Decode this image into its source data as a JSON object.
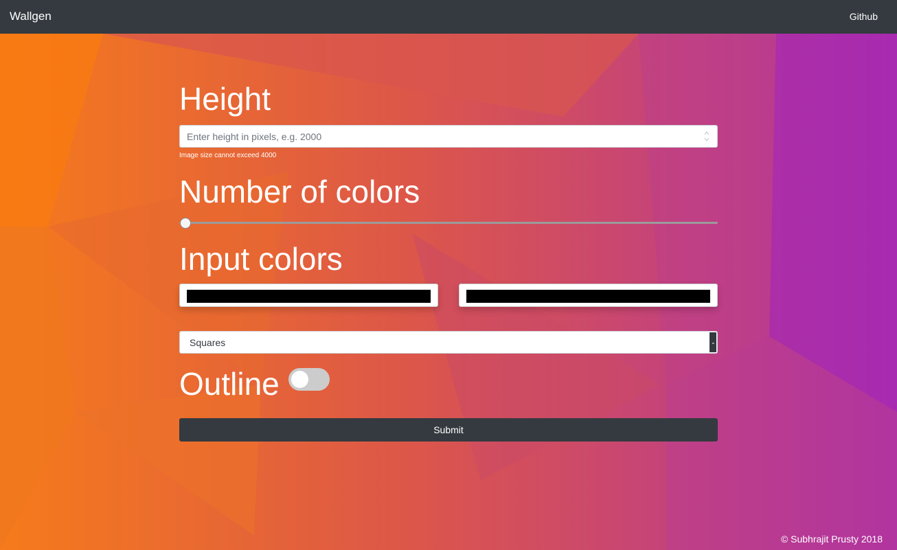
{
  "navbar": {
    "brand": "Wallgen",
    "github_label": "Github"
  },
  "form": {
    "height_heading": "Height",
    "height_placeholder": "Enter height in pixels, e.g. 2000",
    "height_help": "Image size cannot exceed 4000",
    "colors_count_heading": "Number of colors",
    "colors_count_value": 0,
    "input_colors_heading": "Input colors",
    "color_inputs": [
      "#000000",
      "#000000"
    ],
    "shape_select": {
      "selected": "Squares"
    },
    "outline_label": "Outline",
    "outline_enabled": false,
    "submit_label": "Submit"
  },
  "footer": {
    "copyright": "© Subhrajit Prusty 2018"
  },
  "colors": {
    "navbar": "#343a40",
    "background_left": "#f57a1c",
    "background_right": "#a82bb0"
  }
}
